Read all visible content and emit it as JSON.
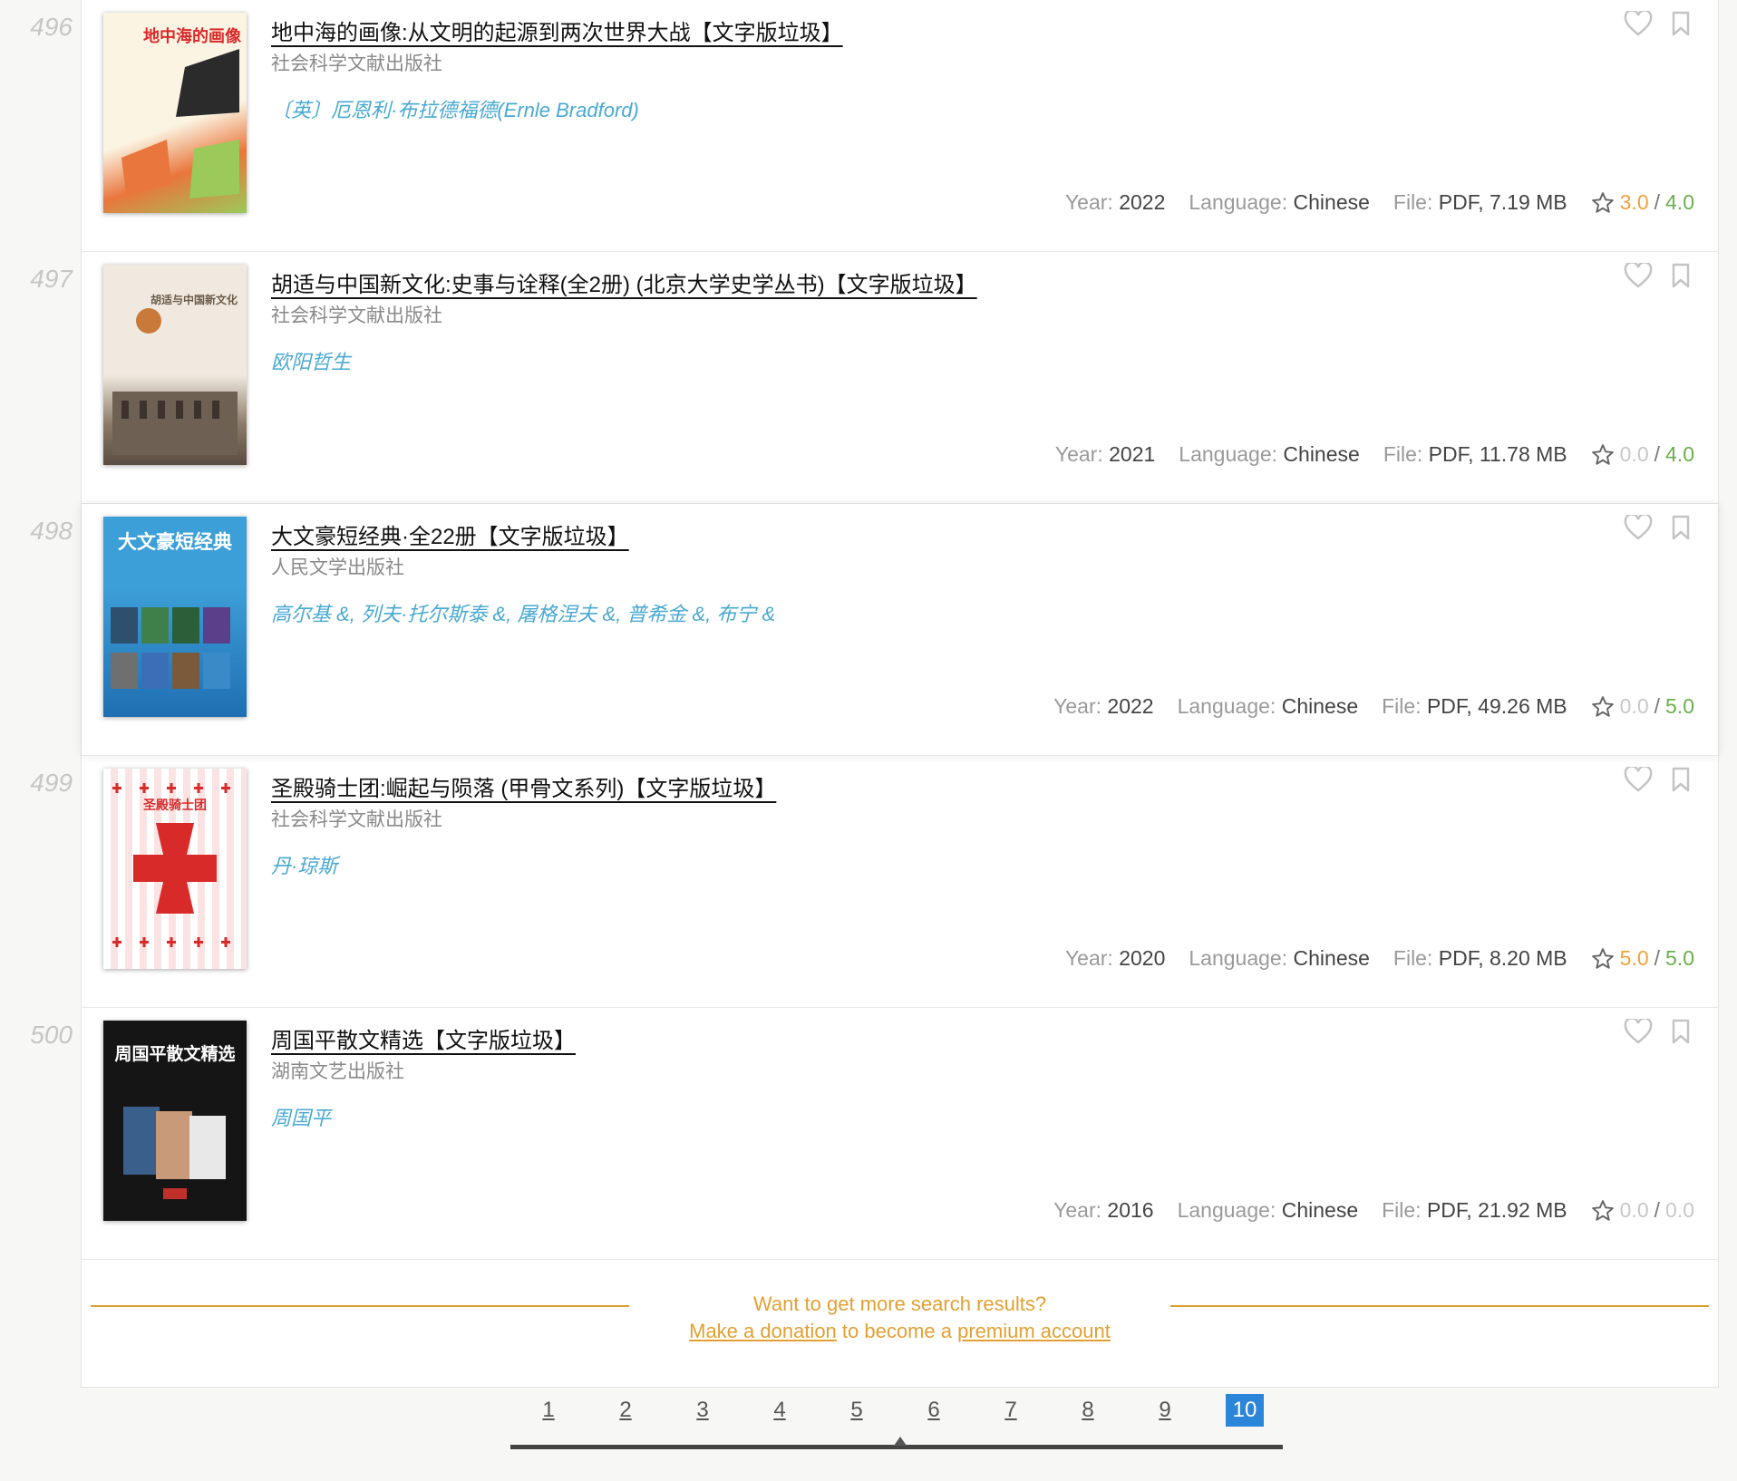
{
  "books": [
    {
      "number": "496",
      "title": "地中海的画像:从文明的起源到两次世界大战【文字版垃圾】",
      "publisher": "社会科学文献出版社",
      "authors": "〔英〕厄恩利·布拉德福德(Ernle Bradford)",
      "cover_text": "地中海的画像",
      "cover_colors": [
        "#fbf4e2",
        "#e9763c"
      ],
      "year_label": "Year:",
      "year": "2022",
      "language_label": "Language:",
      "language": "Chinese",
      "file_label": "File:",
      "file": "PDF, 7.19 MB",
      "rating_user": "3.0",
      "rating_sep": "/",
      "rating_quality": "4.0",
      "rating_user_color": "orange"
    },
    {
      "number": "497",
      "title": "胡适与中国新文化:史事与诠释(全2册) (北京大学史学丛书)【文字版垃圾】",
      "publisher": "社会科学文献出版社",
      "authors": "欧阳哲生",
      "cover_text": "胡适与中国新文化",
      "cover_colors": [
        "#efe9df",
        "#8a7a66"
      ],
      "year_label": "Year:",
      "year": "2021",
      "language_label": "Language:",
      "language": "Chinese",
      "file_label": "File:",
      "file": "PDF, 11.78 MB",
      "rating_user": "0.0",
      "rating_sep": "/",
      "rating_quality": "4.0",
      "rating_user_color": "grey"
    },
    {
      "number": "498",
      "title": "大文豪短经典·全22册【文字版垃圾】",
      "publisher": "人民文学出版社",
      "authors": "高尔基 &, 列夫·托尔斯泰 &, 屠格涅夫 &, 普希金 &, 布宁 &",
      "cover_text": "大文豪短经典",
      "cover_colors": [
        "#3d9fd8",
        "#1f6fb3"
      ],
      "year_label": "Year:",
      "year": "2022",
      "language_label": "Language:",
      "language": "Chinese",
      "file_label": "File:",
      "file": "PDF, 49.26 MB",
      "rating_user": "0.0",
      "rating_sep": "/",
      "rating_quality": "5.0",
      "rating_user_color": "grey"
    },
    {
      "number": "499",
      "title": "圣殿骑士团:崛起与陨落 (甲骨文系列)【文字版垃圾】",
      "publisher": "社会科学文献出版社",
      "authors": "丹·琼斯",
      "cover_text": "圣殿骑士团",
      "cover_colors": [
        "#ffffff",
        "#d92a2a"
      ],
      "year_label": "Year:",
      "year": "2020",
      "language_label": "Language:",
      "language": "Chinese",
      "file_label": "File:",
      "file": "PDF, 8.20 MB",
      "rating_user": "5.0",
      "rating_sep": "/",
      "rating_quality": "5.0",
      "rating_user_color": "orange"
    },
    {
      "number": "500",
      "title": "周国平散文精选【文字版垃圾】",
      "publisher": "湖南文艺出版社",
      "authors": "周国平",
      "cover_text": "周国平散文精选",
      "cover_colors": [
        "#151515",
        "#3a5f8a"
      ],
      "year_label": "Year:",
      "year": "2016",
      "language_label": "Language:",
      "language": "Chinese",
      "file_label": "File:",
      "file": "PDF, 21.92 MB",
      "rating_user": "0.0",
      "rating_sep": "/",
      "rating_quality": "0.0",
      "rating_user_color": "grey",
      "rating_quality_color": "grey"
    }
  ],
  "promo": {
    "line1": "Want to get more search results?",
    "donation_link": "Make a donation",
    "middle": " to become a ",
    "premium_link": "premium account"
  },
  "pagination": {
    "pages": [
      "1",
      "2",
      "3",
      "4",
      "5",
      "6",
      "7",
      "8",
      "9",
      "10"
    ],
    "active": "10"
  },
  "colors": {
    "accent": "#2b85d8",
    "author": "#49a9d2",
    "promo": "#e2a032",
    "rating_green": "#6ab04c",
    "rating_orange": "#f1a23c"
  },
  "icons": {
    "favorite": "heart-icon",
    "bookmark": "bookmark-icon",
    "rating": "star-icon"
  }
}
